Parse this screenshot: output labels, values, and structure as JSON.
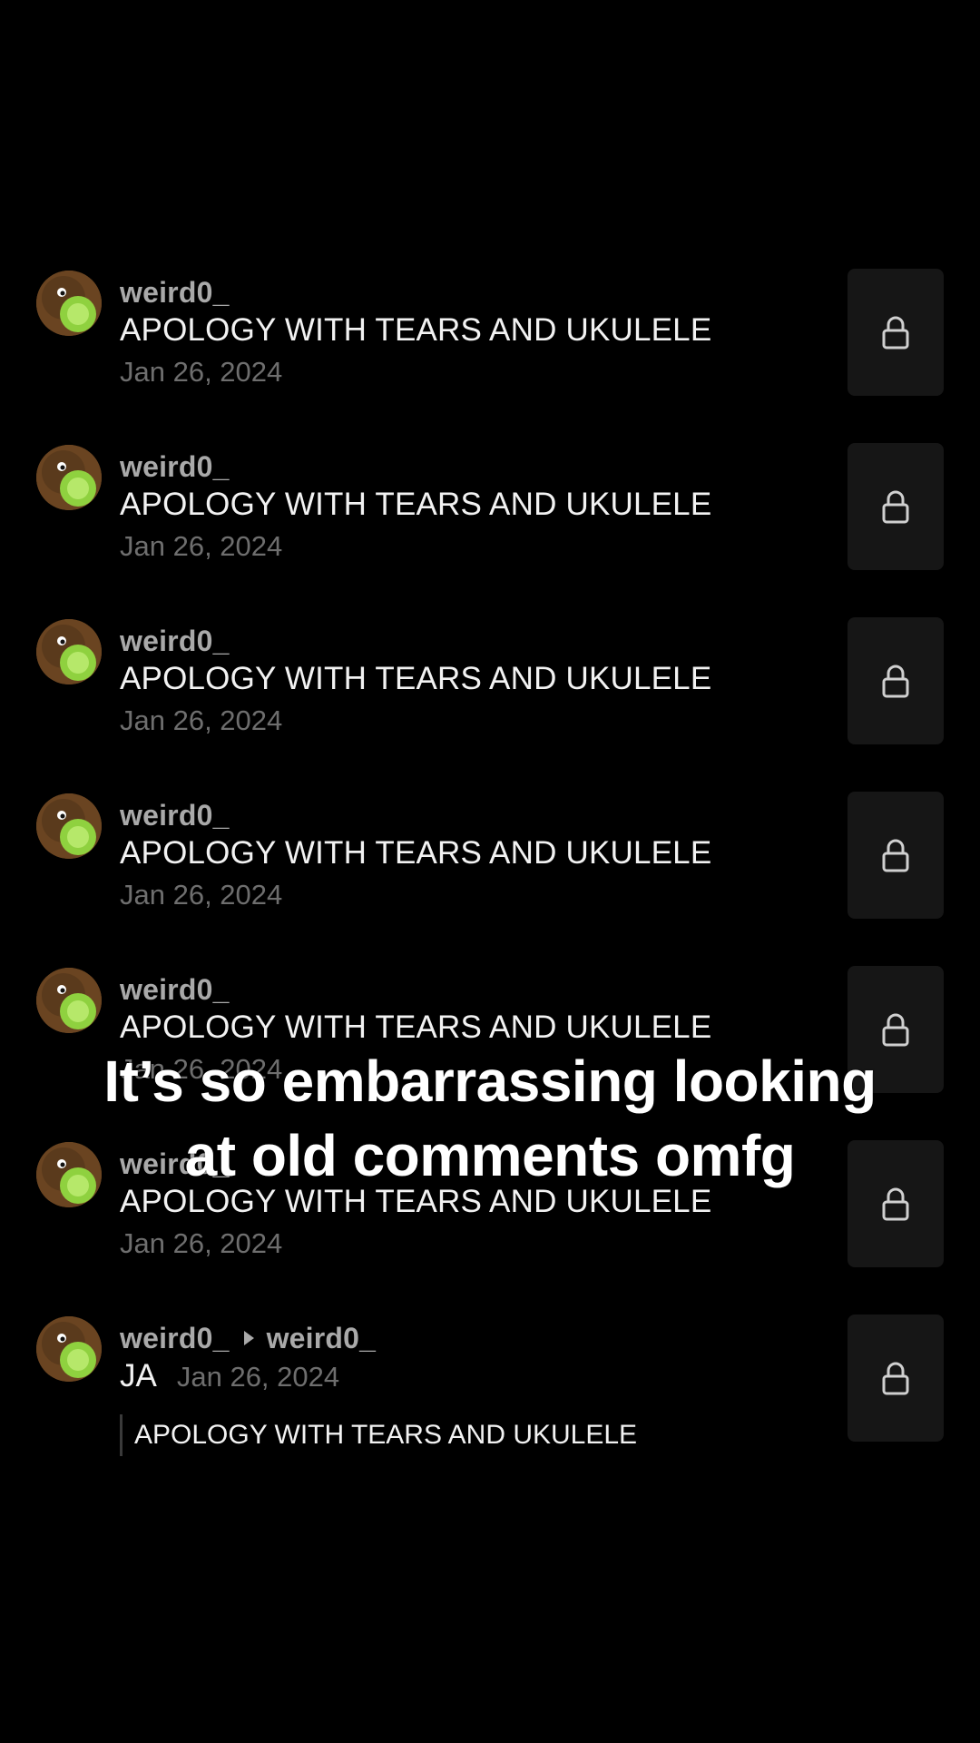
{
  "comments": [
    {
      "username": "weird0_",
      "text": "APOLOGY WITH TEARS AND UKULELE",
      "date": "Jan 26, 2024"
    },
    {
      "username": "weird0_",
      "text": "APOLOGY WITH TEARS AND UKULELE",
      "date": "Jan 26, 2024"
    },
    {
      "username": "weird0_",
      "text": "APOLOGY WITH TEARS AND UKULELE",
      "date": "Jan 26, 2024"
    },
    {
      "username": "weird0_",
      "text": "APOLOGY WITH TEARS AND UKULELE",
      "date": "Jan 26, 2024"
    },
    {
      "username": "weird0_",
      "text": "APOLOGY WITH TEARS AND UKULELE",
      "date": "Jan 26, 2024"
    },
    {
      "username": "weird0_",
      "text": "APOLOGY WITH TEARS AND UKULELE",
      "date": "Jan 26, 2024"
    }
  ],
  "reply": {
    "username": "weird0_",
    "reply_to": "weird0_",
    "text": "JA",
    "date": "Jan 26, 2024",
    "quoted_text": "APOLOGY WITH TEARS AND UKULELE"
  },
  "caption": {
    "line1": "It’s so embarrassing looking",
    "line2": "at old comments omfg"
  },
  "icons": {
    "lock": "lock-icon",
    "reply_arrow": "triangle-right-icon",
    "avatar": "kiwi-avatar"
  },
  "colors": {
    "background": "#000000",
    "username": "#a9a9a9",
    "date": "#6e6e6e",
    "lock_box": "#161616"
  }
}
